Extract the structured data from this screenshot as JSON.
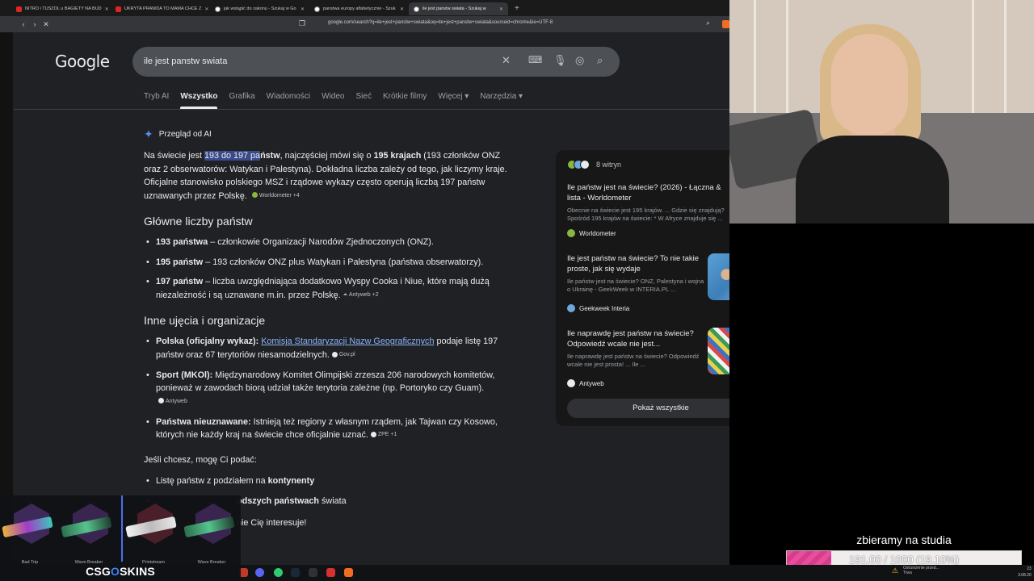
{
  "browser": {
    "tabs": [
      {
        "title": "NITRO i TUSZOL u BAGIETY NA BUD",
        "favicon": "youtube-icon",
        "active": false
      },
      {
        "title": "UKRYTA PRAWDA TO MAMA CHCE Z",
        "favicon": "youtube-icon",
        "active": false
      },
      {
        "title": "jak wstąpić do zakonu - Szukaj w Go",
        "favicon": "google-icon",
        "active": false
      },
      {
        "title": "panstwa europy alfabetycznie - Szuk",
        "favicon": "google-icon",
        "active": false
      },
      {
        "title": "ile jest panstw swiata - Szukaj w",
        "favicon": "google-icon",
        "active": true
      }
    ],
    "new_tab": "+",
    "url": "google.com/search?q=ile+jest+panstw+swiata&oq=ile+jest+panstw+swiata&sourceid=chrome&ie=UTF-8"
  },
  "google": {
    "logo": "Google",
    "query": "ile jest panstw swiata",
    "tabs": [
      "Tryb AI",
      "Wszystko",
      "Grafika",
      "Wiadomości",
      "Wideo",
      "Sieć",
      "Krótkie filmy",
      "Więcej",
      "Narzędzia"
    ],
    "selected_tab": "Wszystko"
  },
  "ai_overview": {
    "header": "Przegląd od AI",
    "intro": {
      "pre": "Na świecie jest ",
      "highlight_a": "193 do 197 pa",
      "highlight_b": "ństw",
      "mid": ", najczęściej mówi się o ",
      "bold": "195 krajach",
      "post": " (193 członków ONZ oraz 2 obserwatorów: Watykan i Palestyna). Dokładna liczba zależy od tego, jak liczymy kraje. Oficjalne stanowisko polskiego MSZ i rządowe wykazy często operują liczbą 197 państw uznawanych przez Polskę.",
      "chip": "Worldometer +4"
    },
    "section1_title": "Główne liczby państw",
    "section1_items": [
      {
        "bold": "193 państwa",
        "text": " – członkowie Organizacji Narodów Zjednoczonych (ONZ).",
        "chip": ""
      },
      {
        "bold": "195 państw",
        "text": " – 193 członków ONZ plus Watykan i Palestyna (państwa obserwatorzy).",
        "chip": ""
      },
      {
        "bold": "197 państw",
        "text": " – liczba uwzględniająca dodatkowo Wyspy Cooka i Niue, które mają dużą niezależność i są uznawane m.in. przez Polskę.",
        "chip": "Antyweb +2"
      }
    ],
    "section2_title": "Inne ujęcia i organizacje",
    "section2_items": [
      {
        "bold": "Polska (oficjalny wykaz):",
        "link": "Komisja Standaryzacji Nazw Geograficznych",
        "text": " podaje listę 197 państw oraz 67 terytoriów niesamodzielnych.",
        "chip": "Gov.pl"
      },
      {
        "bold": "Sport (MKOl):",
        "link": "",
        "text": " Międzynarodowy Komitet Olimpijski zrzesza 206 narodowych komitetów, ponieważ w zawodach biorą udział także terytoria zależne (np. Portoryko czy Guam).",
        "chip": "Antyweb"
      },
      {
        "bold": "Państwa nieuznawane:",
        "link": "",
        "text": " Istnieją też regiony z własnym rządem, jak Tajwan czy Kosowo, których nie każdy kraj na świecie chce oficjalnie uznać.",
        "chip": "ZPE +1"
      }
    ],
    "offer": "Jeśli chcesz, mogę Ci podać:",
    "offer_items": [
      {
        "pre": "Listę państw z podziałem na ",
        "bold": "kontynenty",
        "post": ""
      },
      {
        "pre": "",
        "bold": "odszych państwach",
        "post": " świata"
      },
      {
        "pre": "",
        "bold": "",
        "post": "nie Cię interesuje!"
      }
    ]
  },
  "sources": {
    "count_label": "8 witryn",
    "cards": [
      {
        "title": "Ile państw jest na świecie? (2026) - Łączna & lista - Worldometer",
        "snippet": "Obecnie na świecie jest 195 krajów. ... Gdzie się znajdują? Spośród 195 krajów na świecie: * W Afryce znajduje się ...",
        "site": "Worldometer"
      },
      {
        "title": "Ile jest państw na świecie? To nie takie proste, jak się wydaje",
        "snippet": "Ile państw jest na świecie? ONZ, Palestyna i wojna o Ukrainę - GeekWeek w INTERIA.PL ...",
        "site": "Geekweek Interia"
      },
      {
        "title": "Ile naprawdę jest państw na świecie? Odpowiedź wcale nie jest...",
        "snippet": "Ile naprawdę jest państw na świecie? Odpowiedź wcale nie jest prosta! ... Ile ...",
        "site": "Antyweb"
      }
    ],
    "show_all": "Pokaż wszystkie"
  },
  "stream": {
    "goal_title": "zbieramy na studia",
    "goal_progress": "191.00 / 1000 (19.10%)",
    "goal_fraction": 0.191,
    "goal_color": "#e94d9d"
  },
  "skins_overlay": {
    "items": [
      "Bad Trip",
      "Wave Breaker",
      "Printstream",
      "Wave Breaker"
    ],
    "logo_pre": "CSG",
    "logo_mid": "O",
    "logo_post": "SKINS"
  },
  "taskbar": {
    "notification": "Ostrzeżenie przed...\nTrwa",
    "clock_line1": "23",
    "clock_line2": "3.08.20"
  }
}
